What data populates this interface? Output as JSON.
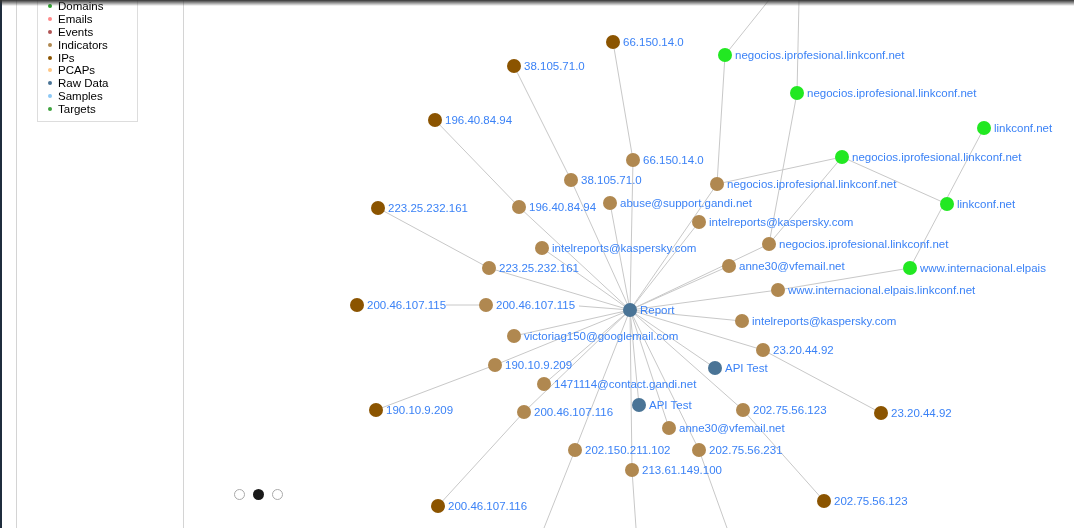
{
  "legend": {
    "items": [
      {
        "label": "Domains",
        "color": "#2ca02c"
      },
      {
        "label": "Emails",
        "color": "#ff8a8a"
      },
      {
        "label": "Events",
        "color": "#b05555"
      },
      {
        "label": "Indicators",
        "color": "#b08850"
      },
      {
        "label": "IPs",
        "color": "#8b5400"
      },
      {
        "label": "PCAPs",
        "color": "#ffc785"
      },
      {
        "label": "Raw Data",
        "color": "#4a7496"
      },
      {
        "label": "Samples",
        "color": "#8cc8f5"
      },
      {
        "label": "Targets",
        "color": "#3fa33f"
      }
    ]
  },
  "graph": {
    "nodes": [
      {
        "label": "66.150.14.0",
        "color": "#8b5400"
      },
      {
        "label": "negocios.iprofesional.linkconf.net",
        "color": "#22e822"
      },
      {
        "label": "38.105.71.0",
        "color": "#8b5400"
      },
      {
        "label": "negocios.iprofesional.linkconf.net",
        "color": "#22e822"
      },
      {
        "label": "196.40.84.94",
        "color": "#8b5400"
      },
      {
        "label": "linkconf.net",
        "color": "#22e822"
      },
      {
        "label": "66.150.14.0",
        "color": "#b08850"
      },
      {
        "label": "negocios.iprofesional.linkconf.net",
        "color": "#22e822"
      },
      {
        "label": "38.105.71.0",
        "color": "#b08850"
      },
      {
        "label": "negocios.iprofesional.linkconf.net",
        "color": "#b08850"
      },
      {
        "label": "223.25.232.161",
        "color": "#8b5400"
      },
      {
        "label": "196.40.84.94",
        "color": "#b08850"
      },
      {
        "label": "abuse@support.gandi.net",
        "color": "#b08850"
      },
      {
        "label": "linkconf.net",
        "color": "#22e822"
      },
      {
        "label": "intelreports@kaspersky.com",
        "color": "#b08850"
      },
      {
        "label": "intelreports@kaspersky.com",
        "color": "#b08850"
      },
      {
        "label": "negocios.iprofesional.linkconf.net",
        "color": "#b08850"
      },
      {
        "label": "223.25.232.161",
        "color": "#b08850"
      },
      {
        "label": "anne30@vfemail.net",
        "color": "#b08850"
      },
      {
        "label": "www.internacional.elpais",
        "color": "#22e822"
      },
      {
        "label": "www.internacional.elpais.linkconf.net",
        "color": "#b08850"
      },
      {
        "label": "200.46.107.115",
        "color": "#8b5400"
      },
      {
        "label": "200.46.107.115",
        "color": "#b08850"
      },
      {
        "label": "Report",
        "color": "#4a7496"
      },
      {
        "label": "intelreports@kaspersky.com",
        "color": "#b08850"
      },
      {
        "label": "victoriag150@googlemail.com",
        "color": "#b08850"
      },
      {
        "label": "23.20.44.92",
        "color": "#b08850"
      },
      {
        "label": "190.10.9.209",
        "color": "#b08850"
      },
      {
        "label": "API Test",
        "color": "#4a7496"
      },
      {
        "label": "1471114@contact.gandi.net",
        "color": "#b08850"
      },
      {
        "label": "190.10.9.209",
        "color": "#8b5400"
      },
      {
        "label": "200.46.107.116",
        "color": "#b08850"
      },
      {
        "label": "API Test",
        "color": "#4a7496"
      },
      {
        "label": "202.75.56.123",
        "color": "#b08850"
      },
      {
        "label": "23.20.44.92",
        "color": "#8b5400"
      },
      {
        "label": "anne30@vfemail.net",
        "color": "#b08850"
      },
      {
        "label": "202.150.211.102",
        "color": "#b08850"
      },
      {
        "label": "202.75.56.231",
        "color": "#b08850"
      },
      {
        "label": "213.61.149.100",
        "color": "#b08850"
      },
      {
        "label": "200.46.107.116",
        "color": "#8b5400"
      },
      {
        "label": "202.75.56.123",
        "color": "#8b5400"
      }
    ]
  },
  "carousel": {
    "dots": [
      {
        "selected": false
      },
      {
        "selected": true
      },
      {
        "selected": false
      }
    ]
  }
}
